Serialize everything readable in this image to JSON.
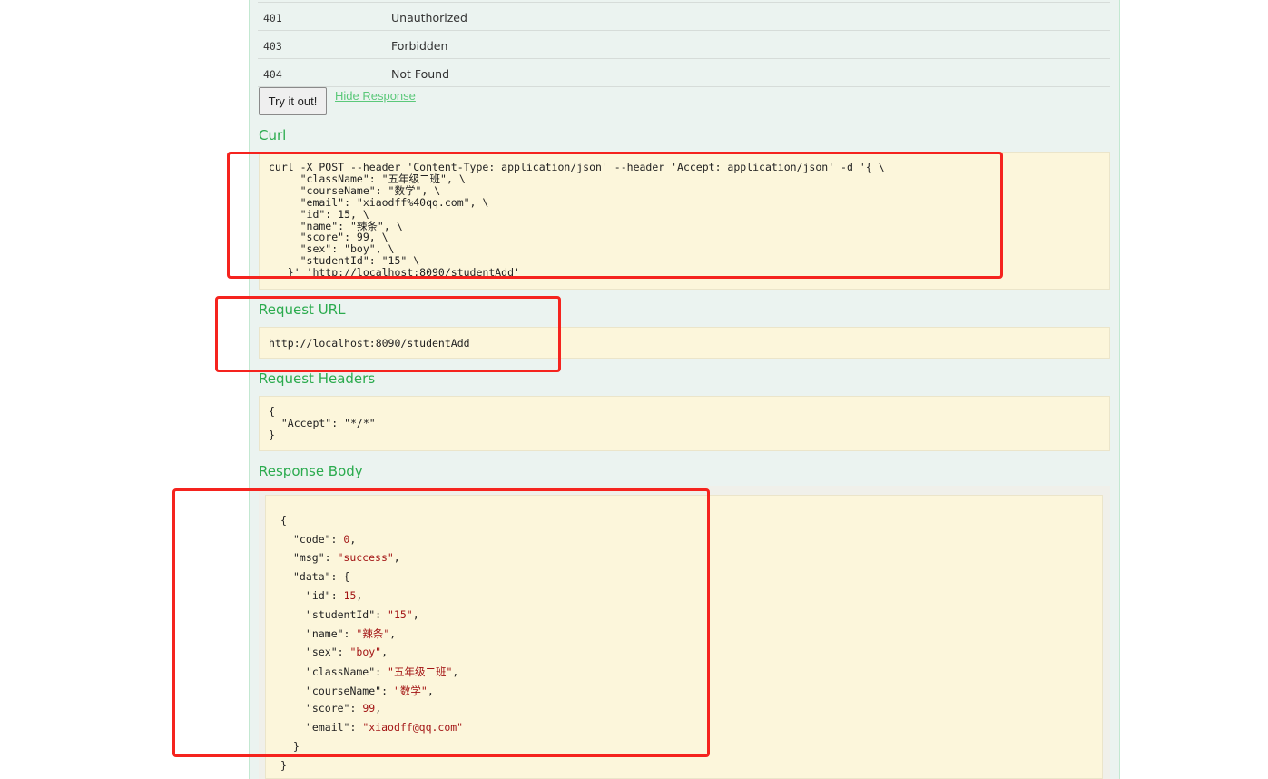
{
  "response_codes": [
    {
      "code": "401",
      "reason": "Unauthorized"
    },
    {
      "code": "403",
      "reason": "Forbidden"
    },
    {
      "code": "404",
      "reason": "Not Found"
    }
  ],
  "actions": {
    "try_label": "Try it out!",
    "hide_label": "Hide Response"
  },
  "curl": {
    "title": "Curl",
    "lines": [
      "curl -X POST --header 'Content-Type: application/json' --header 'Accept: application/json' -d '{ \\",
      "     \"className\": \"五年级二班\", \\",
      "     \"courseName\": \"数学\", \\",
      "     \"email\": \"xiaodff%40qq.com\", \\",
      "     \"id\": 15, \\",
      "     \"name\": \"辣条\", \\",
      "     \"score\": 99, \\",
      "     \"sex\": \"boy\", \\",
      "     \"studentId\": \"15\" \\",
      "   }' 'http://localhost:8090/studentAdd'"
    ]
  },
  "request_url": {
    "title": "Request URL",
    "value": "http://localhost:8090/studentAdd"
  },
  "request_headers": {
    "title": "Request Headers",
    "lines": [
      "{",
      "  \"Accept\": \"*/*\"",
      "}"
    ]
  },
  "response_body": {
    "title": "Response Body",
    "code": "0",
    "msg": "\"success\"",
    "data": {
      "id": "15",
      "studentId": "\"15\"",
      "name": "\"辣条\"",
      "sex": "\"boy\"",
      "className": "\"五年级二班\"",
      "courseName": "\"数学\"",
      "score": "99",
      "email": "\"xiaodff@qq.com\""
    }
  },
  "colors": {
    "accent": "#2bab4e",
    "annotation": "#f5231e",
    "code_bg": "#fcf6db",
    "panel_bg": "#ebf3f0"
  }
}
